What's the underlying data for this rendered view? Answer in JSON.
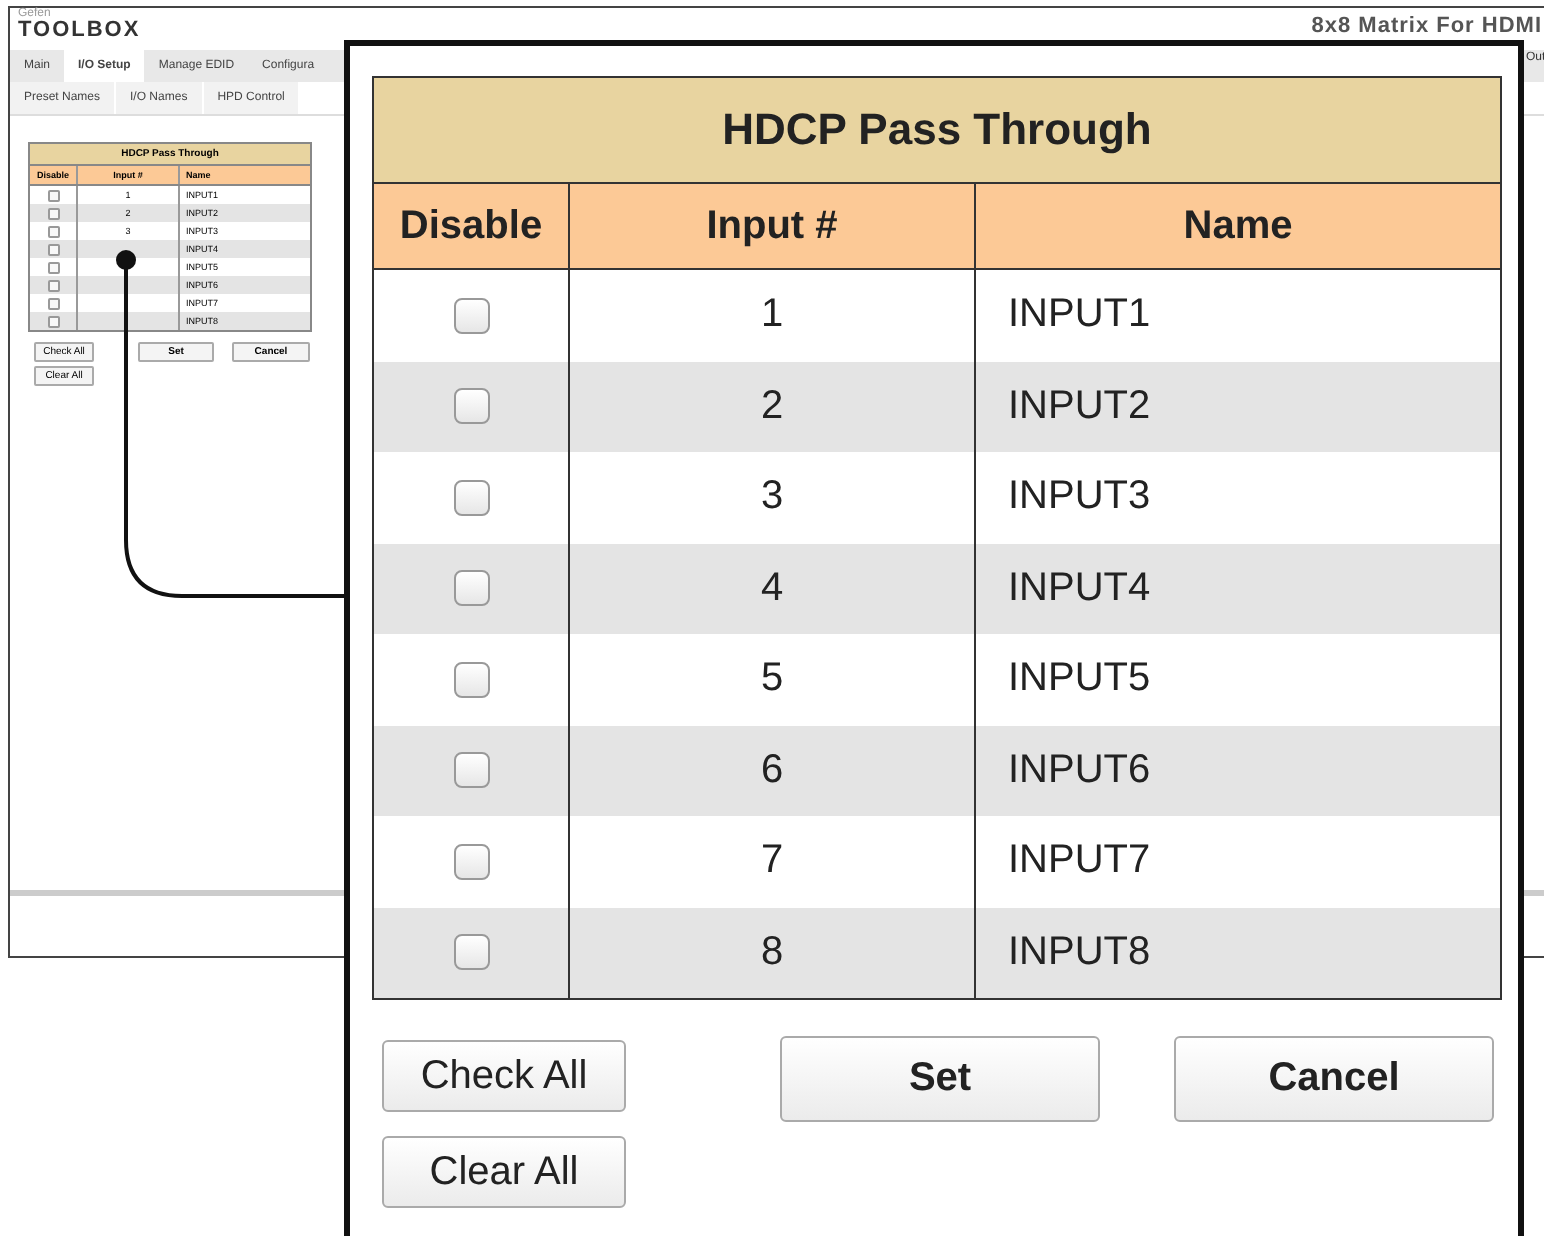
{
  "app": {
    "brand_small": "Gefen",
    "brand": "TOOLBOX",
    "title": "8x8 Matrix For HDMI",
    "edge_label": "Out"
  },
  "tabs": [
    {
      "label": "Main",
      "selected": false
    },
    {
      "label": "I/O Setup",
      "selected": true
    },
    {
      "label": "Manage EDID",
      "selected": false
    },
    {
      "label": "Configura",
      "selected": false
    }
  ],
  "subtabs": [
    {
      "label": "Preset Names"
    },
    {
      "label": "I/O Names"
    },
    {
      "label": "HPD Control"
    }
  ],
  "small_table": {
    "title": "HDCP Pass Through",
    "columns": [
      "Disable",
      "Input #",
      "Name"
    ],
    "rows": [
      {
        "checked": false,
        "input": "1",
        "name": "INPUT1"
      },
      {
        "checked": false,
        "input": "2",
        "name": "INPUT2"
      },
      {
        "checked": false,
        "input": "3",
        "name": "INPUT3"
      },
      {
        "checked": false,
        "name": "INPUT4"
      },
      {
        "checked": false,
        "name": "INPUT5"
      },
      {
        "checked": false,
        "name": "INPUT6"
      },
      {
        "checked": false,
        "name": "INPUT7"
      },
      {
        "checked": false,
        "name": "INPUT8"
      }
    ],
    "buttons": {
      "check_all": "Check All",
      "set": "Set",
      "cancel": "Cancel",
      "clear_all": "Clear All"
    }
  },
  "callout": {
    "title": "HDCP Pass Through",
    "columns": [
      "Disable",
      "Input #",
      "Name"
    ],
    "rows": [
      {
        "checked": false,
        "input": "1",
        "name": "INPUT1"
      },
      {
        "checked": false,
        "input": "2",
        "name": "INPUT2"
      },
      {
        "checked": false,
        "input": "3",
        "name": "INPUT3"
      },
      {
        "checked": false,
        "input": "4",
        "name": "INPUT4"
      },
      {
        "checked": false,
        "input": "5",
        "name": "INPUT5"
      },
      {
        "checked": false,
        "input": "6",
        "name": "INPUT6"
      },
      {
        "checked": false,
        "input": "7",
        "name": "INPUT7"
      },
      {
        "checked": false,
        "input": "8",
        "name": "INPUT8"
      }
    ],
    "buttons": {
      "check_all": "Check All",
      "set": "Set",
      "cancel": "Cancel",
      "clear_all": "Clear All"
    }
  }
}
